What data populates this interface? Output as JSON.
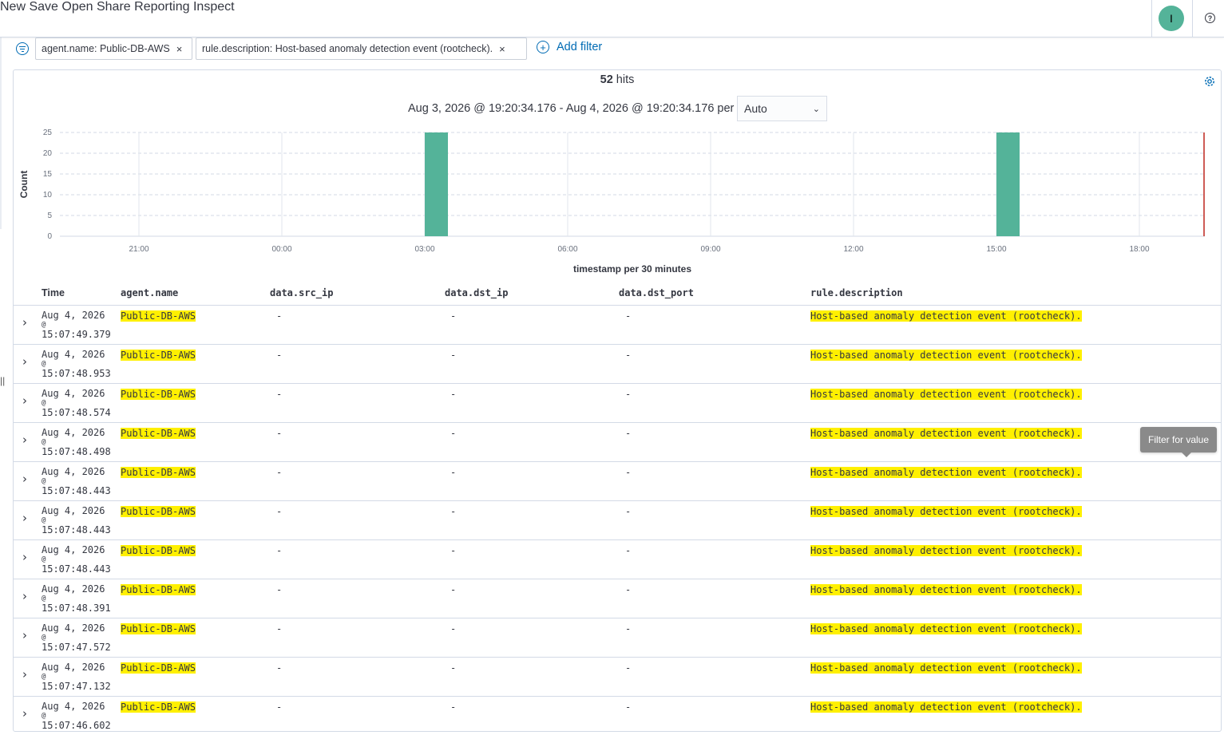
{
  "topnav": {
    "new": "New",
    "save": "Save",
    "open": "Open",
    "share": "Share",
    "reporting": "Reporting",
    "inspect": "Inspect",
    "avatar_initial": "I"
  },
  "filters": {
    "pills": [
      "agent.name: Public-DB-AWS",
      "rule.description: Host-based anomaly detection event (rootcheck)."
    ],
    "add_filter": "Add filter"
  },
  "hits": {
    "count": "52",
    "label": "hits"
  },
  "time_range": {
    "text": "Aug 3, 2026 @ 19:20:34.176 - Aug 4, 2026 @ 19:20:34.176 per",
    "interval": "Auto"
  },
  "chart_data": {
    "type": "bar",
    "ylabel": "Count",
    "xlabel": "timestamp per 30 minutes",
    "ylim": [
      0,
      25
    ],
    "yticks": [
      "0",
      "5",
      "10",
      "15",
      "20",
      "25"
    ],
    "xticks": [
      "21:00",
      "00:00",
      "03:00",
      "06:00",
      "09:00",
      "12:00",
      "15:00",
      "18:00"
    ],
    "bars": [
      {
        "x": "03:00",
        "value": 26
      },
      {
        "x": "15:00",
        "value": 26
      }
    ],
    "color": "#54b399",
    "grid": true
  },
  "table": {
    "columns": [
      "Time",
      "agent.name",
      "data.src_ip",
      "data.dst_ip",
      "data.dst_port",
      "rule.description"
    ],
    "rows": [
      {
        "date": "Aug 4, 2026",
        "at": "@",
        "time": "15:07:49.379",
        "agent": "Public-DB-AWS",
        "src": "-",
        "dst": "-",
        "port": "-",
        "desc": "Host-based anomaly detection event (rootcheck)."
      },
      {
        "date": "Aug 4, 2026",
        "at": "@",
        "time": "15:07:48.953",
        "agent": "Public-DB-AWS",
        "src": "-",
        "dst": "-",
        "port": "-",
        "desc": "Host-based anomaly detection event (rootcheck)."
      },
      {
        "date": "Aug 4, 2026",
        "at": "@",
        "time": "15:07:48.574",
        "agent": "Public-DB-AWS",
        "src": "-",
        "dst": "-",
        "port": "-",
        "desc": "Host-based anomaly detection event (rootcheck)."
      },
      {
        "date": "Aug 4, 2026",
        "at": "@",
        "time": "15:07:48.498",
        "agent": "Public-DB-AWS",
        "src": "-",
        "dst": "-",
        "port": "-",
        "desc": "Host-based anomaly detection event (rootcheck)."
      },
      {
        "date": "Aug 4, 2026",
        "at": "@",
        "time": "15:07:48.443",
        "agent": "Public-DB-AWS",
        "src": "-",
        "dst": "-",
        "port": "-",
        "desc": "Host-based anomaly detection event (rootcheck)."
      },
      {
        "date": "Aug 4, 2026",
        "at": "@",
        "time": "15:07:48.443",
        "agent": "Public-DB-AWS",
        "src": "-",
        "dst": "-",
        "port": "-",
        "desc": "Host-based anomaly detection event (rootcheck)."
      },
      {
        "date": "Aug 4, 2026",
        "at": "@",
        "time": "15:07:48.443",
        "agent": "Public-DB-AWS",
        "src": "-",
        "dst": "-",
        "port": "-",
        "desc": "Host-based anomaly detection event (rootcheck)."
      },
      {
        "date": "Aug 4, 2026",
        "at": "@",
        "time": "15:07:48.391",
        "agent": "Public-DB-AWS",
        "src": "-",
        "dst": "-",
        "port": "-",
        "desc": "Host-based anomaly detection event (rootcheck)."
      },
      {
        "date": "Aug 4, 2026",
        "at": "@",
        "time": "15:07:47.572",
        "agent": "Public-DB-AWS",
        "src": "-",
        "dst": "-",
        "port": "-",
        "desc": "Host-based anomaly detection event (rootcheck)."
      },
      {
        "date": "Aug 4, 2026",
        "at": "@",
        "time": "15:07:47.132",
        "agent": "Public-DB-AWS",
        "src": "-",
        "dst": "-",
        "port": "-",
        "desc": "Host-based anomaly detection event (rootcheck)."
      },
      {
        "date": "Aug 4, 2026",
        "at": "@",
        "time": "15:07:46.602",
        "agent": "Public-DB-AWS",
        "src": "-",
        "dst": "-",
        "port": "-",
        "desc": "Host-based anomaly detection event (rootcheck)."
      }
    ]
  },
  "tooltip": "Filter for value",
  "icons": {
    "filter_menu": "filter-menu-icon",
    "add": "plus-circle-icon",
    "settings": "gear-icon",
    "help": "help-icon",
    "expand": "chevron-right-icon",
    "close": "close-icon",
    "dropdown": "chevron-down-icon"
  }
}
